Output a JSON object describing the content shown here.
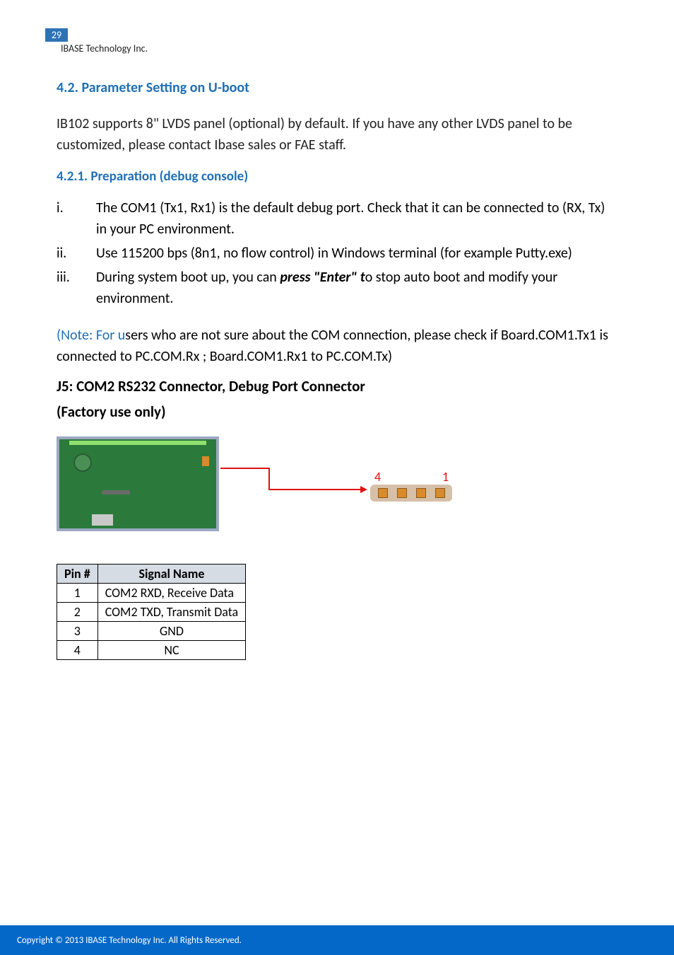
{
  "page": {
    "number": "29",
    "org": "IBASE Technology Inc."
  },
  "headings": {
    "h42": "4.2.   Parameter Setting on U-boot",
    "h421": "4.2.1.  Preparation (debug console)",
    "j5": "J5: COM2 RS232 Connector, Debug Port Connector",
    "factory": "(Factory use only)"
  },
  "paragraphs": {
    "intro": "IB102 supports 8\" LVDS panel (optional) by default. If you have any other LVDS panel to be customized, please contact Ibase sales or FAE staff."
  },
  "list": {
    "items": [
      {
        "num": "i.",
        "text": "The COM1 (Tx1, Rx1) is the default debug port. Check that it can be connected to (RX, Tx) in your PC environment."
      },
      {
        "num": "ii.",
        "text": "Use 115200 bps (8n1, no flow control) in Windows terminal (for example Putty.exe)"
      },
      {
        "num": "iii.",
        "pre": "During system boot up, you can ",
        "em": "press \"Enter\" t",
        "post": "o stop auto boot and modify your environment."
      }
    ]
  },
  "note": {
    "blue": "(Note: For u",
    "rest": "sers who are not sure about the COM connection, please check if Board.COM1.Tx1 is connected to PC.COM.Rx ;    Board.COM1.Rx1 to PC.COM.Tx)"
  },
  "connector_labels": {
    "left": "4",
    "right": "1"
  },
  "table": {
    "headers": {
      "pin": "Pin #",
      "signal": "Signal Name"
    },
    "rows": [
      {
        "pin": "1",
        "signal": "COM2 RXD, Receive Data",
        "align": "l"
      },
      {
        "pin": "2",
        "signal": "COM2 TXD, Transmit Data",
        "align": "l"
      },
      {
        "pin": "3",
        "signal": "GND",
        "align": "c"
      },
      {
        "pin": "4",
        "signal": "NC",
        "align": "c"
      }
    ]
  },
  "footer": {
    "text": "Copyright © 2013 IBASE Technology Inc. All Rights Reserved."
  }
}
